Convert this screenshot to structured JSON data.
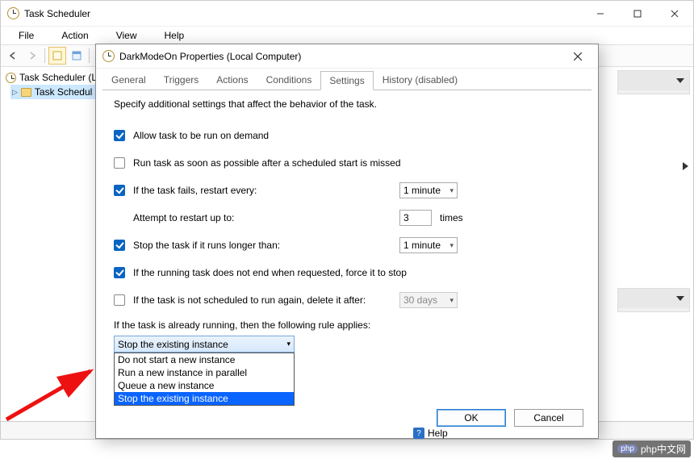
{
  "app": {
    "title": "Task Scheduler"
  },
  "menus": {
    "file": "File",
    "action": "Action",
    "view": "View",
    "help": "Help"
  },
  "tree": {
    "root": "Task Scheduler (L",
    "lib": "Task Schedul"
  },
  "dialog": {
    "title": "DarkModeOn Properties (Local Computer)",
    "tabs": {
      "general": "General",
      "triggers": "Triggers",
      "actions": "Actions",
      "conditions": "Conditions",
      "settings": "Settings",
      "history": "History (disabled)"
    },
    "desc": "Specify additional settings that affect the behavior of the task.",
    "allow_on_demand": "Allow task to be run on demand",
    "run_asap": "Run task as soon as possible after a scheduled start is missed",
    "if_fails": "If the task fails, restart every:",
    "restart_interval": "1 minute",
    "attempt_label": "Attempt to restart up to:",
    "attempt_value": "3",
    "attempt_suffix": "times",
    "stop_longer": "Stop the task if it runs longer than:",
    "stop_longer_value": "1 minute",
    "force_stop": "If the running task does not end when requested, force it to stop",
    "delete_after": "If the task is not scheduled to run again, delete it after:",
    "delete_after_value": "30 days",
    "rule_label": "If the task is already running, then the following rule applies:",
    "rule_selected": "Stop the existing instance",
    "rule_options": [
      "Do not start a new instance",
      "Run a new instance in parallel",
      "Queue a new instance",
      "Stop the existing instance"
    ],
    "ok": "OK",
    "cancel": "Cancel"
  },
  "help_fragment": "Help",
  "watermark": "php中文网"
}
